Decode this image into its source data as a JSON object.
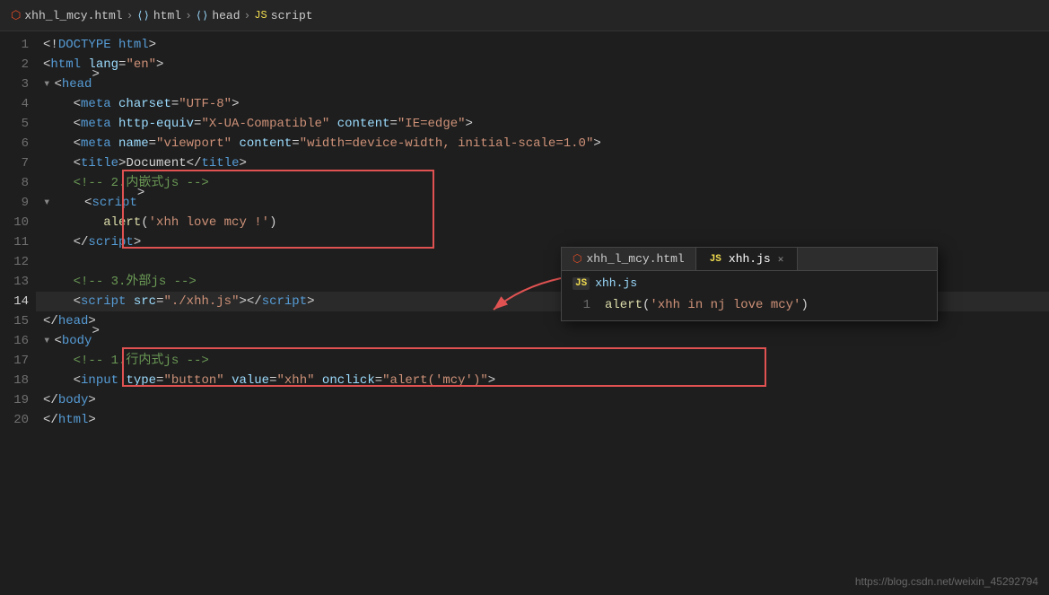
{
  "breadcrumb": {
    "items": [
      {
        "icon": "html-icon",
        "label": "xhh_l_mcy.html"
      },
      {
        "icon": "tag-icon",
        "label": "html"
      },
      {
        "icon": "tag-icon",
        "label": "head"
      },
      {
        "icon": "js-icon",
        "label": "script"
      }
    ]
  },
  "lines": [
    {
      "num": 1,
      "indent": 1,
      "code_html": "<span class='lt-gt'>&lt;!</span><span class='doctype-kw'>DOCTYPE html</span><span class='lt-gt'>&gt;</span>"
    },
    {
      "num": 2,
      "indent": 1,
      "code_html": "<span class='lt-gt'>&lt;</span><span class='tag-name'>html</span> <span class='attr-name'>lang</span>=<span class='attr-val'>\"en\"</span><span class='lt-gt'>&gt;</span>"
    },
    {
      "num": 3,
      "indent": 1,
      "code_html": "<span class='lt-gt'>&lt;</span><span class='tag-name'>head</span><span class='lt-gt'>&gt;</span>",
      "collapse": true
    },
    {
      "num": 4,
      "indent": 2,
      "code_html": "    <span class='lt-gt'>&lt;</span><span class='tag-name'>meta</span> <span class='attr-name'>charset</span>=<span class='attr-val'>\"UTF-8\"</span><span class='lt-gt'>&gt;</span>"
    },
    {
      "num": 5,
      "indent": 2,
      "code_html": "    <span class='lt-gt'>&lt;</span><span class='tag-name'>meta</span> <span class='attr-name'>http-equiv</span>=<span class='attr-val'>\"X-UA-Compatible\"</span> <span class='attr-name'>content</span>=<span class='attr-val'>\"IE=edge\"</span><span class='lt-gt'>&gt;</span>"
    },
    {
      "num": 6,
      "indent": 2,
      "code_html": "    <span class='lt-gt'>&lt;</span><span class='tag-name'>meta</span> <span class='attr-name'>name</span>=<span class='attr-val'>\"viewport\"</span> <span class='attr-name'>content</span>=<span class='attr-val'>\"width=device-width, initial-scale=1.0\"</span><span class='lt-gt'>&gt;</span>"
    },
    {
      "num": 7,
      "indent": 2,
      "code_html": "    <span class='lt-gt'>&lt;</span><span class='tag-name'>title</span><span class='lt-gt'>&gt;</span><span class='text-content'>Document</span><span class='lt-gt'>&lt;/</span><span class='tag-name'>title</span><span class='lt-gt'>&gt;</span>"
    },
    {
      "num": 8,
      "indent": 2,
      "code_html": "    <span class='comment'>&lt;!-- 2.内嵌式js --&gt;</span>",
      "highlight_start": true
    },
    {
      "num": 9,
      "indent": 2,
      "code_html": "    <span class='lt-gt'>&lt;</span><span class='tag-name'>script</span><span class='lt-gt'>&gt;</span>",
      "collapse": true
    },
    {
      "num": 10,
      "indent": 3,
      "code_html": "        <span class='fn-name'>alert</span><span class='punct'>(</span><span class='string'>'xhh love mcy !'</span><span class='punct'>)</span>"
    },
    {
      "num": 11,
      "indent": 2,
      "code_html": "    <span class='lt-gt'>&lt;/</span><span class='tag-name'>script</span><span class='lt-gt'>&gt;</span>",
      "highlight_end": true
    },
    {
      "num": 12,
      "indent": 0,
      "code_html": ""
    },
    {
      "num": 13,
      "indent": 2,
      "code_html": "    <span class='comment'>&lt;!-- 3.外部js --&gt;</span>"
    },
    {
      "num": 14,
      "indent": 2,
      "code_html": "    <span class='lt-gt'>&lt;</span><span class='tag-name'>script</span> <span class='attr-name'>src</span>=<span class='attr-val'>\"./xhh.js\"</span><span class='lt-gt'>&gt;&lt;/</span><span class='tag-name'>script</span><span class='lt-gt'>&gt;</span>"
    },
    {
      "num": 15,
      "indent": 1,
      "code_html": "<span class='lt-gt'>&lt;/</span><span class='tag-name'>head</span><span class='lt-gt'>&gt;</span>"
    },
    {
      "num": 16,
      "indent": 1,
      "code_html": "<span class='lt-gt'>&lt;</span><span class='tag-name'>body</span><span class='lt-gt'>&gt;</span>",
      "collapse": true
    },
    {
      "num": 17,
      "indent": 2,
      "code_html": "    <span class='comment'>&lt;!-- 1.行内式js --&gt;</span>",
      "highlight2_start": true
    },
    {
      "num": 18,
      "indent": 2,
      "code_html": "    <span class='lt-gt'>&lt;</span><span class='tag-name'>input</span> <span class='attr-name'>type</span>=<span class='attr-val'>\"button\"</span> <span class='attr-name'>value</span>=<span class='attr-val'>\"xhh\"</span> <span class='attr-name'>onclick</span>=<span class='attr-val'>\"alert('mcy')\"</span><span class='lt-gt'>&gt;</span>",
      "highlight2_end": true
    },
    {
      "num": 19,
      "indent": 1,
      "code_html": "<span class='lt-gt'>&lt;/</span><span class='tag-name'>body</span><span class='lt-gt'>&gt;</span>"
    },
    {
      "num": 20,
      "indent": 1,
      "code_html": "<span class='lt-gt'>&lt;/</span><span class='tag-name'>html</span><span class='lt-gt'>&gt;</span>"
    }
  ],
  "popup": {
    "tabs": [
      {
        "label": "xhh_l_mcy.html",
        "icon": "html",
        "active": false
      },
      {
        "label": "xhh.js",
        "icon": "js",
        "active": true
      }
    ],
    "file_label": "xhh.js",
    "code_line_num": "1",
    "code_content": "alert('xhh in nj love mcy')"
  },
  "watermark": "https://blog.csdn.net/weixin_45292794"
}
